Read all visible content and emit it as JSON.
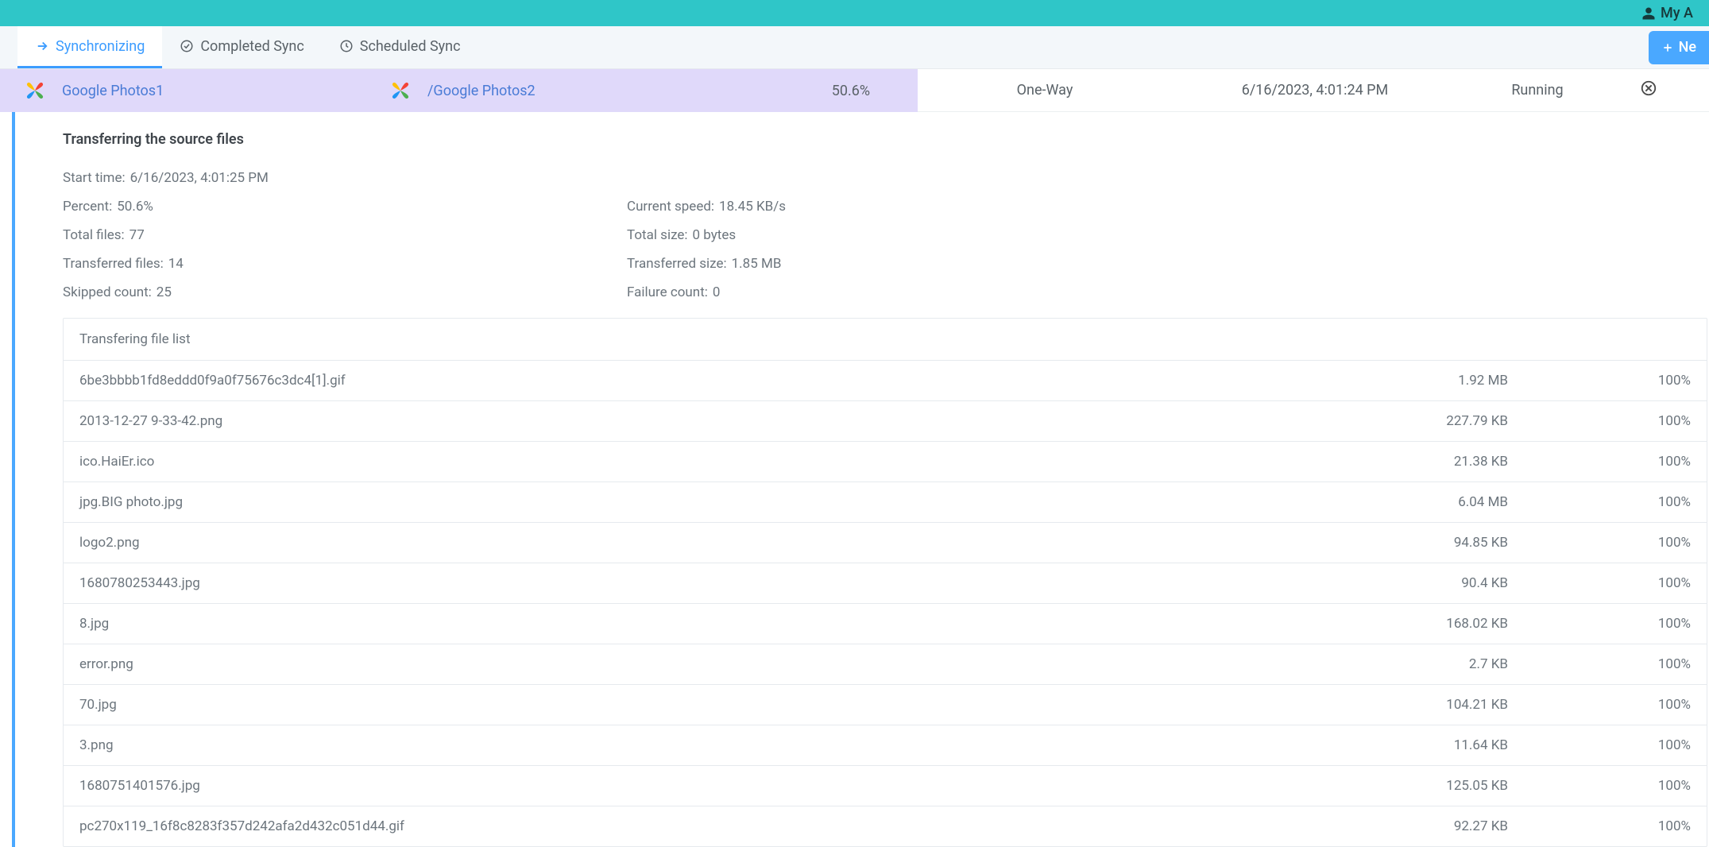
{
  "header": {
    "account_label": "My A"
  },
  "tabs": {
    "synchronizing": "Synchronizing",
    "completed": "Completed Sync",
    "scheduled": "Scheduled Sync"
  },
  "new_button": "Ne",
  "task": {
    "source_name": "Google Photos1",
    "dest_name": "/Google Photos2",
    "percent": "50.6%",
    "mode": "One-Way",
    "time": "6/16/2023, 4:01:24 PM",
    "status": "Running"
  },
  "detail": {
    "title": "Transferring the source files",
    "start_time_label": "Start time",
    "start_time": "6/16/2023, 4:01:25 PM",
    "percent_label": "Percent",
    "percent": "50.6%",
    "total_files_label": "Total files",
    "total_files": "77",
    "transferred_files_label": "Transferred files",
    "transferred_files": "14",
    "skipped_label": "Skipped count",
    "skipped": "25",
    "speed_label": "Current speed",
    "speed": "18.45 KB/s",
    "total_size_label": "Total size",
    "total_size": "0 bytes",
    "transferred_size_label": "Transferred size",
    "transferred_size": "1.85 MB",
    "failure_label": "Failure count",
    "failure": "0"
  },
  "file_list_header": "Transfering file list",
  "files": [
    {
      "name": "6be3bbbb1fd8eddd0f9a0f75676c3dc4[1].gif",
      "size": "1.92 MB",
      "progress": "100%"
    },
    {
      "name": "2013-12-27 9-33-42.png",
      "size": "227.79 KB",
      "progress": "100%"
    },
    {
      "name": "ico.HaiEr.ico",
      "size": "21.38 KB",
      "progress": "100%"
    },
    {
      "name": "jpg.BIG photo.jpg",
      "size": "6.04 MB",
      "progress": "100%"
    },
    {
      "name": "logo2.png",
      "size": "94.85 KB",
      "progress": "100%"
    },
    {
      "name": "1680780253443.jpg",
      "size": "90.4 KB",
      "progress": "100%"
    },
    {
      "name": "8.jpg",
      "size": "168.02 KB",
      "progress": "100%"
    },
    {
      "name": "error.png",
      "size": "2.7 KB",
      "progress": "100%"
    },
    {
      "name": "70.jpg",
      "size": "104.21 KB",
      "progress": "100%"
    },
    {
      "name": "3.png",
      "size": "11.64 KB",
      "progress": "100%"
    },
    {
      "name": "1680751401576.jpg",
      "size": "125.05 KB",
      "progress": "100%"
    },
    {
      "name": "pc270x119_16f8c8283f357d242afa2d432c051d44.gif",
      "size": "92.27 KB",
      "progress": "100%"
    }
  ]
}
